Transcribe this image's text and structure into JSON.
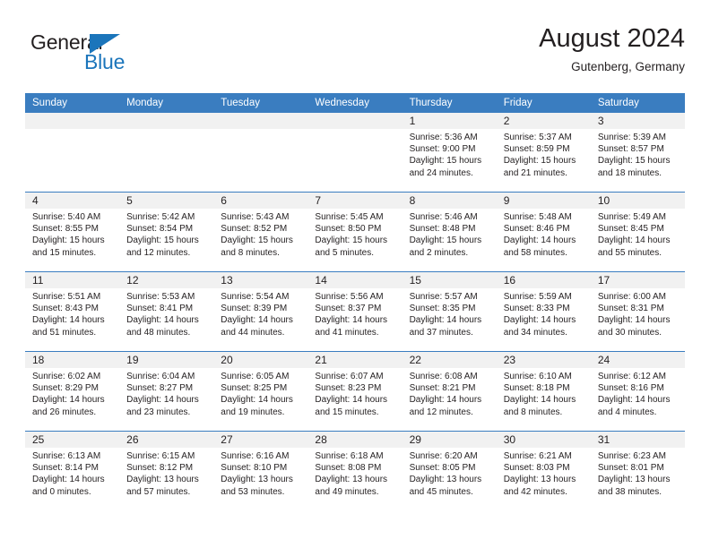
{
  "logo": {
    "word_top": "General",
    "word_bottom": "Blue",
    "triangle_color": "#1b75bb"
  },
  "header": {
    "title": "August 2024",
    "subtitle": "Gutenberg, Germany"
  },
  "theme": {
    "header_blue": "#3a7dc0",
    "daynum_gray": "#f1f1f1",
    "text": "#231f20"
  },
  "weekdays": [
    "Sunday",
    "Monday",
    "Tuesday",
    "Wednesday",
    "Thursday",
    "Friday",
    "Saturday"
  ],
  "labels": {
    "sunrise_prefix": "Sunrise:",
    "sunset_prefix": "Sunset:",
    "daylight_prefix": "Daylight:"
  },
  "weeks": [
    [
      {
        "empty": true
      },
      {
        "empty": true
      },
      {
        "empty": true
      },
      {
        "empty": true
      },
      {
        "day": "1",
        "sunrise": "Sunrise: 5:36 AM",
        "sunset": "Sunset: 9:00 PM",
        "daylight1": "Daylight: 15 hours",
        "daylight2": "and 24 minutes."
      },
      {
        "day": "2",
        "sunrise": "Sunrise: 5:37 AM",
        "sunset": "Sunset: 8:59 PM",
        "daylight1": "Daylight: 15 hours",
        "daylight2": "and 21 minutes."
      },
      {
        "day": "3",
        "sunrise": "Sunrise: 5:39 AM",
        "sunset": "Sunset: 8:57 PM",
        "daylight1": "Daylight: 15 hours",
        "daylight2": "and 18 minutes."
      }
    ],
    [
      {
        "day": "4",
        "sunrise": "Sunrise: 5:40 AM",
        "sunset": "Sunset: 8:55 PM",
        "daylight1": "Daylight: 15 hours",
        "daylight2": "and 15 minutes."
      },
      {
        "day": "5",
        "sunrise": "Sunrise: 5:42 AM",
        "sunset": "Sunset: 8:54 PM",
        "daylight1": "Daylight: 15 hours",
        "daylight2": "and 12 minutes."
      },
      {
        "day": "6",
        "sunrise": "Sunrise: 5:43 AM",
        "sunset": "Sunset: 8:52 PM",
        "daylight1": "Daylight: 15 hours",
        "daylight2": "and 8 minutes."
      },
      {
        "day": "7",
        "sunrise": "Sunrise: 5:45 AM",
        "sunset": "Sunset: 8:50 PM",
        "daylight1": "Daylight: 15 hours",
        "daylight2": "and 5 minutes."
      },
      {
        "day": "8",
        "sunrise": "Sunrise: 5:46 AM",
        "sunset": "Sunset: 8:48 PM",
        "daylight1": "Daylight: 15 hours",
        "daylight2": "and 2 minutes."
      },
      {
        "day": "9",
        "sunrise": "Sunrise: 5:48 AM",
        "sunset": "Sunset: 8:46 PM",
        "daylight1": "Daylight: 14 hours",
        "daylight2": "and 58 minutes."
      },
      {
        "day": "10",
        "sunrise": "Sunrise: 5:49 AM",
        "sunset": "Sunset: 8:45 PM",
        "daylight1": "Daylight: 14 hours",
        "daylight2": "and 55 minutes."
      }
    ],
    [
      {
        "day": "11",
        "sunrise": "Sunrise: 5:51 AM",
        "sunset": "Sunset: 8:43 PM",
        "daylight1": "Daylight: 14 hours",
        "daylight2": "and 51 minutes."
      },
      {
        "day": "12",
        "sunrise": "Sunrise: 5:53 AM",
        "sunset": "Sunset: 8:41 PM",
        "daylight1": "Daylight: 14 hours",
        "daylight2": "and 48 minutes."
      },
      {
        "day": "13",
        "sunrise": "Sunrise: 5:54 AM",
        "sunset": "Sunset: 8:39 PM",
        "daylight1": "Daylight: 14 hours",
        "daylight2": "and 44 minutes."
      },
      {
        "day": "14",
        "sunrise": "Sunrise: 5:56 AM",
        "sunset": "Sunset: 8:37 PM",
        "daylight1": "Daylight: 14 hours",
        "daylight2": "and 41 minutes."
      },
      {
        "day": "15",
        "sunrise": "Sunrise: 5:57 AM",
        "sunset": "Sunset: 8:35 PM",
        "daylight1": "Daylight: 14 hours",
        "daylight2": "and 37 minutes."
      },
      {
        "day": "16",
        "sunrise": "Sunrise: 5:59 AM",
        "sunset": "Sunset: 8:33 PM",
        "daylight1": "Daylight: 14 hours",
        "daylight2": "and 34 minutes."
      },
      {
        "day": "17",
        "sunrise": "Sunrise: 6:00 AM",
        "sunset": "Sunset: 8:31 PM",
        "daylight1": "Daylight: 14 hours",
        "daylight2": "and 30 minutes."
      }
    ],
    [
      {
        "day": "18",
        "sunrise": "Sunrise: 6:02 AM",
        "sunset": "Sunset: 8:29 PM",
        "daylight1": "Daylight: 14 hours",
        "daylight2": "and 26 minutes."
      },
      {
        "day": "19",
        "sunrise": "Sunrise: 6:04 AM",
        "sunset": "Sunset: 8:27 PM",
        "daylight1": "Daylight: 14 hours",
        "daylight2": "and 23 minutes."
      },
      {
        "day": "20",
        "sunrise": "Sunrise: 6:05 AM",
        "sunset": "Sunset: 8:25 PM",
        "daylight1": "Daylight: 14 hours",
        "daylight2": "and 19 minutes."
      },
      {
        "day": "21",
        "sunrise": "Sunrise: 6:07 AM",
        "sunset": "Sunset: 8:23 PM",
        "daylight1": "Daylight: 14 hours",
        "daylight2": "and 15 minutes."
      },
      {
        "day": "22",
        "sunrise": "Sunrise: 6:08 AM",
        "sunset": "Sunset: 8:21 PM",
        "daylight1": "Daylight: 14 hours",
        "daylight2": "and 12 minutes."
      },
      {
        "day": "23",
        "sunrise": "Sunrise: 6:10 AM",
        "sunset": "Sunset: 8:18 PM",
        "daylight1": "Daylight: 14 hours",
        "daylight2": "and 8 minutes."
      },
      {
        "day": "24",
        "sunrise": "Sunrise: 6:12 AM",
        "sunset": "Sunset: 8:16 PM",
        "daylight1": "Daylight: 14 hours",
        "daylight2": "and 4 minutes."
      }
    ],
    [
      {
        "day": "25",
        "sunrise": "Sunrise: 6:13 AM",
        "sunset": "Sunset: 8:14 PM",
        "daylight1": "Daylight: 14 hours",
        "daylight2": "and 0 minutes."
      },
      {
        "day": "26",
        "sunrise": "Sunrise: 6:15 AM",
        "sunset": "Sunset: 8:12 PM",
        "daylight1": "Daylight: 13 hours",
        "daylight2": "and 57 minutes."
      },
      {
        "day": "27",
        "sunrise": "Sunrise: 6:16 AM",
        "sunset": "Sunset: 8:10 PM",
        "daylight1": "Daylight: 13 hours",
        "daylight2": "and 53 minutes."
      },
      {
        "day": "28",
        "sunrise": "Sunrise: 6:18 AM",
        "sunset": "Sunset: 8:08 PM",
        "daylight1": "Daylight: 13 hours",
        "daylight2": "and 49 minutes."
      },
      {
        "day": "29",
        "sunrise": "Sunrise: 6:20 AM",
        "sunset": "Sunset: 8:05 PM",
        "daylight1": "Daylight: 13 hours",
        "daylight2": "and 45 minutes."
      },
      {
        "day": "30",
        "sunrise": "Sunrise: 6:21 AM",
        "sunset": "Sunset: 8:03 PM",
        "daylight1": "Daylight: 13 hours",
        "daylight2": "and 42 minutes."
      },
      {
        "day": "31",
        "sunrise": "Sunrise: 6:23 AM",
        "sunset": "Sunset: 8:01 PM",
        "daylight1": "Daylight: 13 hours",
        "daylight2": "and 38 minutes."
      }
    ]
  ]
}
